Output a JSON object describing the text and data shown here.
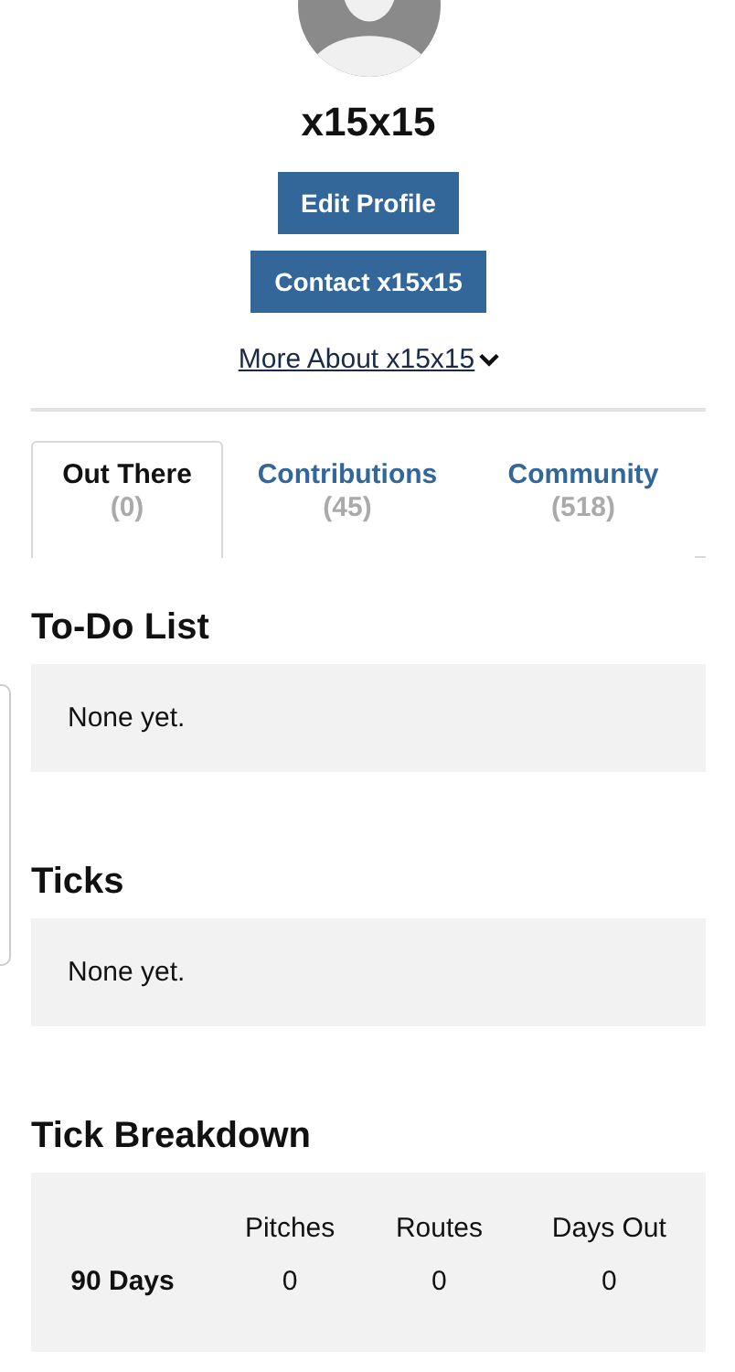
{
  "profile": {
    "username": "x15x15",
    "buttons": [
      "Edit Profile",
      "Contact x15x15"
    ],
    "more_link": "More About x15x15"
  },
  "tabs": [
    {
      "label": "Out There",
      "count": "(0)",
      "selected": true
    },
    {
      "label": "Contributions",
      "count": "(45)",
      "selected": false
    },
    {
      "label": "Community",
      "count": "(518)",
      "selected": false
    }
  ],
  "sections": [
    {
      "title": "To-Do List",
      "empty_text": "None yet."
    },
    {
      "title": "Ticks",
      "empty_text": "None yet."
    }
  ],
  "tick_breakdown": {
    "title": "Tick Breakdown",
    "columns": [
      "Pitches",
      "Routes",
      "Days Out"
    ],
    "rows": [
      {
        "label": "90 Days",
        "cells": [
          "0",
          "0",
          "0"
        ]
      }
    ]
  }
}
